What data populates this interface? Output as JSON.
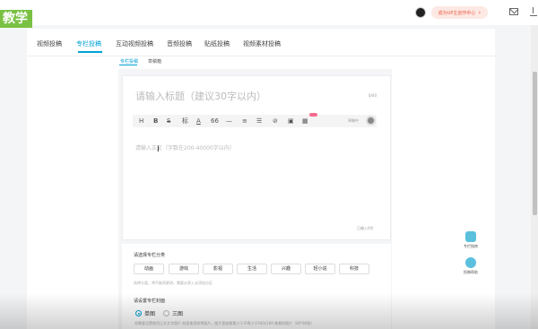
{
  "brand": {
    "logo_text": "教学"
  },
  "header": {
    "upgrade_label": "成为UP主创作中心",
    "upgrade_arrow": "›"
  },
  "tabs": [
    {
      "label": "视频投稿"
    },
    {
      "label": "专栏投稿",
      "active": true
    },
    {
      "label": "互动视频投稿"
    },
    {
      "label": "音频投稿"
    },
    {
      "label": "贴纸投稿"
    },
    {
      "label": "视频素材投稿"
    }
  ],
  "subtabs": [
    {
      "label": "专栏投稿",
      "active": true
    },
    {
      "label": "草稿箱"
    }
  ],
  "editor": {
    "title_placeholder": "请输入标题（建议30字以内）",
    "title_count": "0/40",
    "body_placeholder": "请输入正文（字数在200-40000字以内）",
    "word_count": "已输入0字",
    "toolbar": [
      "H",
      "B",
      "S",
      "标",
      "A",
      "66",
      "—",
      "≡",
      "☰",
      "⊘",
      "▣",
      "▦"
    ],
    "save_label": "草稿中"
  },
  "category": {
    "title": "请选择专栏分类",
    "options": [
      "动画",
      "游戏",
      "影视",
      "生活",
      "兴趣",
      "轻小说",
      "科技"
    ],
    "note": "选择分类，将不能再更改，需要从原入去添加分区"
  },
  "cover": {
    "title": "请设置专栏封面",
    "options": [
      "单图",
      "三图"
    ],
    "selected": "单图",
    "note": "如需要设置使用正文文字图片 前面使用前将图片，图片宽度像素小于不得小于640x180 像素的图片（80*80图）"
  },
  "floating": [
    {
      "label": "专栏指南",
      "icon": "guide-icon"
    },
    {
      "label": "投稿帮助",
      "icon": "help-chat-icon"
    }
  ],
  "colors": {
    "accent": "#00a1d6",
    "logo_bg": "#7ac143",
    "badge": "#f56c8e"
  }
}
